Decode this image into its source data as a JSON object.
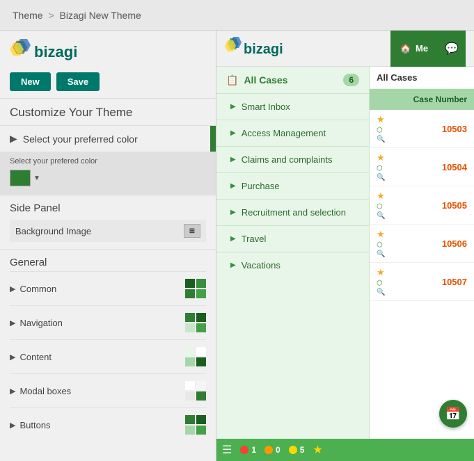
{
  "breadcrumb": {
    "part1": "Theme",
    "separator": ">",
    "part2": "Bizagi New Theme"
  },
  "left_panel": {
    "new_button": "New",
    "save_button": "Save",
    "customize_title": "Customize Your Theme",
    "color_section_label": "Select your preferred color",
    "color_picker_label": "Select your prefered color",
    "color_value": "#2e7d32",
    "side_panel_title": "Side Panel",
    "background_image_label": "Background Image",
    "general_title": "General",
    "general_items": [
      {
        "label": "Common"
      },
      {
        "label": "Navigation"
      },
      {
        "label": "Content"
      },
      {
        "label": "Modal boxes"
      },
      {
        "label": "Buttons"
      }
    ]
  },
  "app": {
    "logo_text": "bizagi",
    "nav_me": "Me",
    "sidebar": {
      "all_cases_label": "All Cases",
      "all_cases_count": "6",
      "items": [
        {
          "label": "Smart Inbox"
        },
        {
          "label": "Access Management"
        },
        {
          "label": "Claims and complaints"
        },
        {
          "label": "Purchase"
        },
        {
          "label": "Recruitment and selection"
        },
        {
          "label": "Travel"
        },
        {
          "label": "Vacations"
        }
      ]
    },
    "cases": {
      "title": "All Cases",
      "column_header": "Case Number",
      "rows": [
        {
          "number": "10503"
        },
        {
          "number": "10504"
        },
        {
          "number": "10505"
        },
        {
          "number": "10506"
        },
        {
          "number": "10507"
        }
      ]
    },
    "bottom_bar": {
      "red_count": "1",
      "orange_count": "0",
      "green_count": "5"
    }
  }
}
